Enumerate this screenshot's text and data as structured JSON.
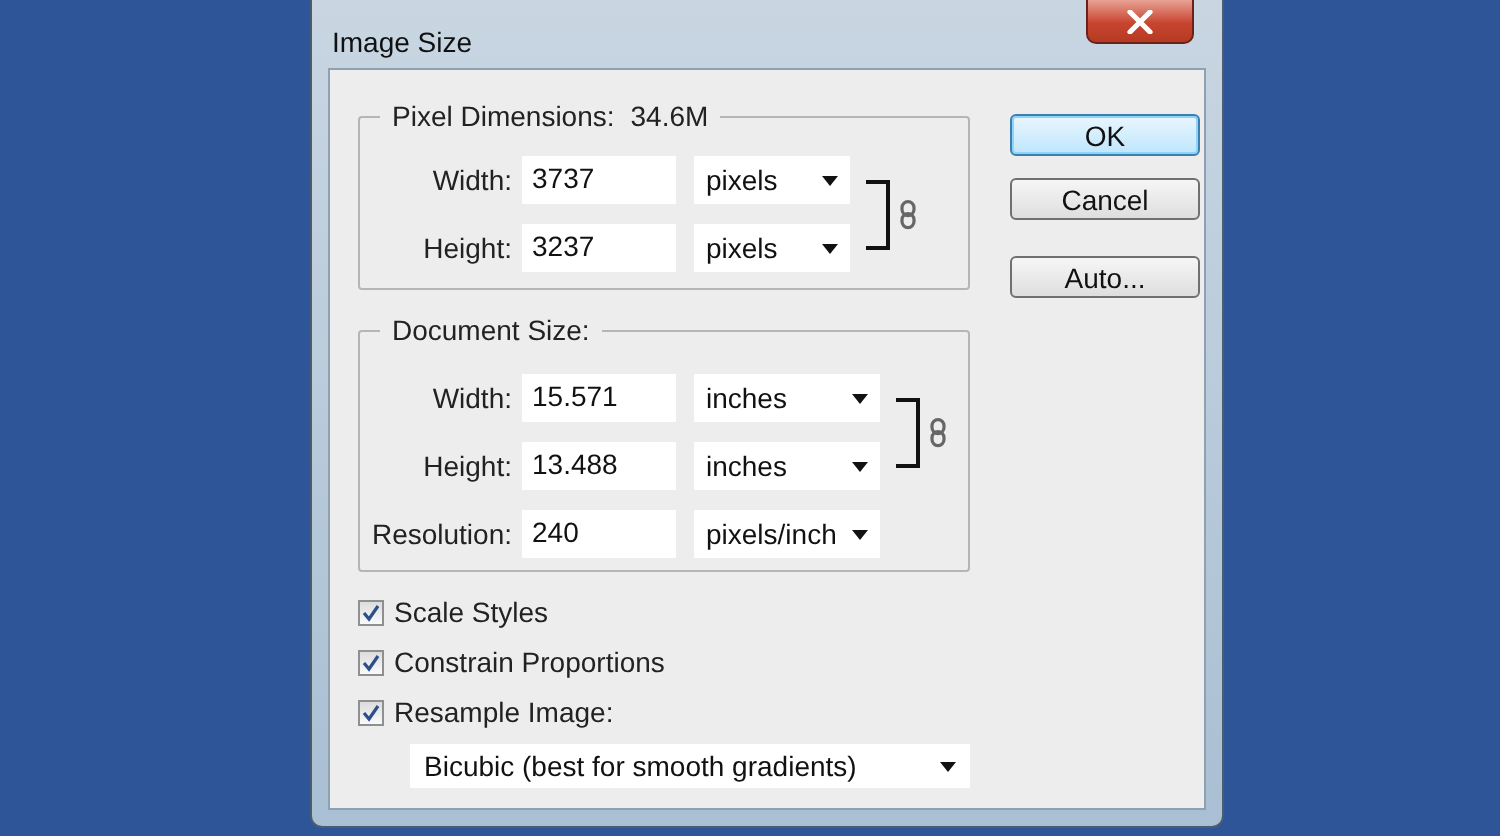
{
  "window": {
    "title": "Image Size"
  },
  "pixel_dimensions": {
    "title": "Pixel Dimensions:",
    "size": "34.6M",
    "fields": [
      {
        "label": "Width:",
        "value": "3737",
        "unit": "pixels",
        "linked": true
      },
      {
        "label": "Height:",
        "value": "3237",
        "unit": "pixels",
        "linked": true
      }
    ]
  },
  "document_size": {
    "title": "Document Size:",
    "fields": [
      {
        "label": "Width:",
        "value": "15.571",
        "unit": "inches",
        "linked": true
      },
      {
        "label": "Height:",
        "value": "13.488",
        "unit": "inches",
        "linked": true
      },
      {
        "label": "Resolution:",
        "value": "240",
        "unit": "pixels/inch",
        "linked": false
      }
    ]
  },
  "options": [
    {
      "label": "Scale Styles",
      "checked": true
    },
    {
      "label": "Constrain Proportions",
      "checked": true
    },
    {
      "label": "Resample Image:",
      "checked": true
    }
  ],
  "resample_method": "Bicubic (best for smooth gradients)",
  "buttons": [
    {
      "label": "OK",
      "default": true
    },
    {
      "label": "Cancel",
      "default": false
    },
    {
      "label": "Auto...",
      "default": false
    }
  ]
}
